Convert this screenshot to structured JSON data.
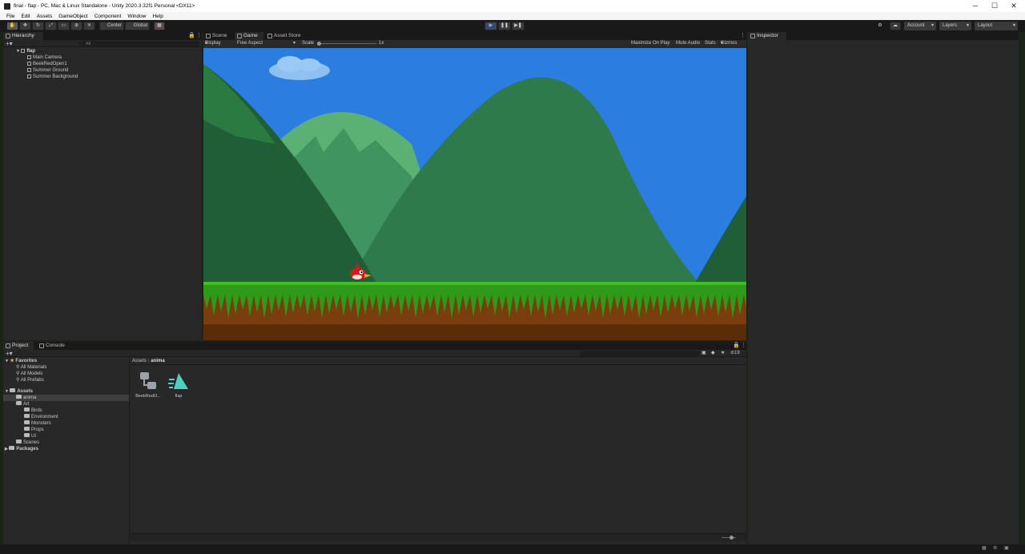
{
  "window": {
    "title": "final - flap - PC, Mac & Linux Standalone - Unity 2020.3.32f1 Personal <DX11>",
    "controls": [
      "─",
      "☐",
      "✕"
    ]
  },
  "menu": [
    "File",
    "Edit",
    "Assets",
    "GameObject",
    "Component",
    "Window",
    "Help"
  ],
  "toolbar": {
    "pivot": "Center",
    "space": "Global",
    "account": "Account",
    "layers": "Layers",
    "layout": "Layout",
    "play_icon": "play-icon",
    "pause_icon": "pause-icon",
    "step_icon": "step-icon"
  },
  "hierarchy": {
    "tab": "Hierarchy",
    "search_placeholder": "All",
    "scene": "flap",
    "items": [
      "Main Camera",
      "BeekRedOpen1",
      "Summer Ground",
      "Summer Background"
    ]
  },
  "center_tabs": [
    "Scene",
    "Game",
    "Asset Store"
  ],
  "game_bar": {
    "display": "Display 1",
    "aspect": "Free Aspect",
    "scale_label": "Scale",
    "scale_value": "1x",
    "scale_level": 0,
    "maximize": "Maximize On Play",
    "mute": "Mute Audio",
    "stats": "Stats",
    "gizmos": "Gizmos"
  },
  "inspector": {
    "tab": "Inspector"
  },
  "project": {
    "tabs": [
      "Project",
      "Console"
    ],
    "favorites_label": "Favorites",
    "favorites": [
      "All Materials",
      "All Models",
      "All Prefabs"
    ],
    "assets_label": "Assets",
    "tree": [
      {
        "label": "anima",
        "level": 1,
        "selected": true
      },
      {
        "label": "Art",
        "level": 1,
        "selected": false
      },
      {
        "label": "Birds",
        "level": 2,
        "selected": false
      },
      {
        "label": "Environment",
        "level": 2,
        "selected": false
      },
      {
        "label": "Monsters",
        "level": 2,
        "selected": false
      },
      {
        "label": "Props",
        "level": 2,
        "selected": false
      },
      {
        "label": "UI",
        "level": 2,
        "selected": false
      },
      {
        "label": "Scenes",
        "level": 1,
        "selected": false
      }
    ],
    "packages_label": "Packages",
    "breadcrumb": [
      "Assets",
      "anima"
    ],
    "assets": [
      {
        "name": "BeekRedO...",
        "icon": "animator-controller-icon"
      },
      {
        "name": "flap",
        "icon": "animation-clip-icon"
      }
    ],
    "hidden_count": "19"
  },
  "colors": {
    "sky": "#2b7de0",
    "grass": "#2e9a1a",
    "dirt": "#7a3d0e",
    "mountain_dark": "#1f5e36",
    "mountain_mid": "#2f7a4a",
    "mountain_light": "#5bb074",
    "play_accent": "#7fb4ff"
  }
}
